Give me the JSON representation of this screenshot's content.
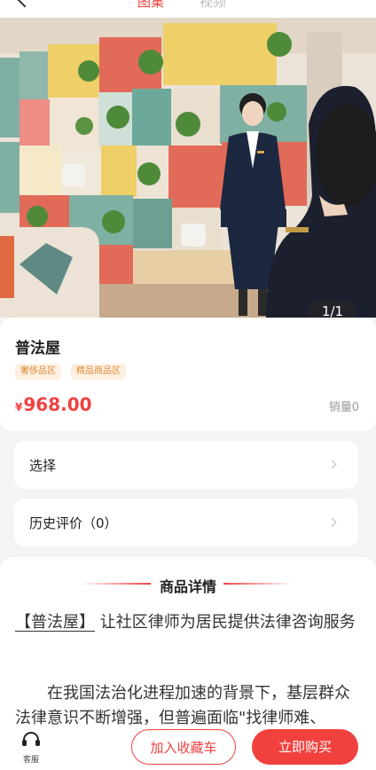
{
  "header": {
    "tabs": [
      {
        "label": "图集"
      },
      {
        "label": "视频"
      }
    ]
  },
  "gallery": {
    "counter": "1/1"
  },
  "product": {
    "title": "普法屋",
    "tags": [
      {
        "label": "奢侈品区"
      },
      {
        "label": "精品商品区"
      }
    ],
    "price_symbol": "¥",
    "price": "968.00",
    "sales": "销量0"
  },
  "options": {
    "select_label": "选择",
    "review_label": "历史评价（0）"
  },
  "detail": {
    "heading": "商品详情",
    "bracket": "【普法屋】",
    "line1_rest": "让社区律师为居民提供法律咨询服务",
    "line2": "在我国法治化进程加速的背景下，基层群众法律意识不断增强，但普遍面临\"找律师难、"
  },
  "bottom": {
    "service_label": "客服",
    "add_cart_label": "加入收藏车",
    "buy_label": "立即购买"
  },
  "colors": {
    "accent": "#f0413f",
    "tag_bg": "#fdf0e2",
    "tag_text": "#e08a35"
  }
}
